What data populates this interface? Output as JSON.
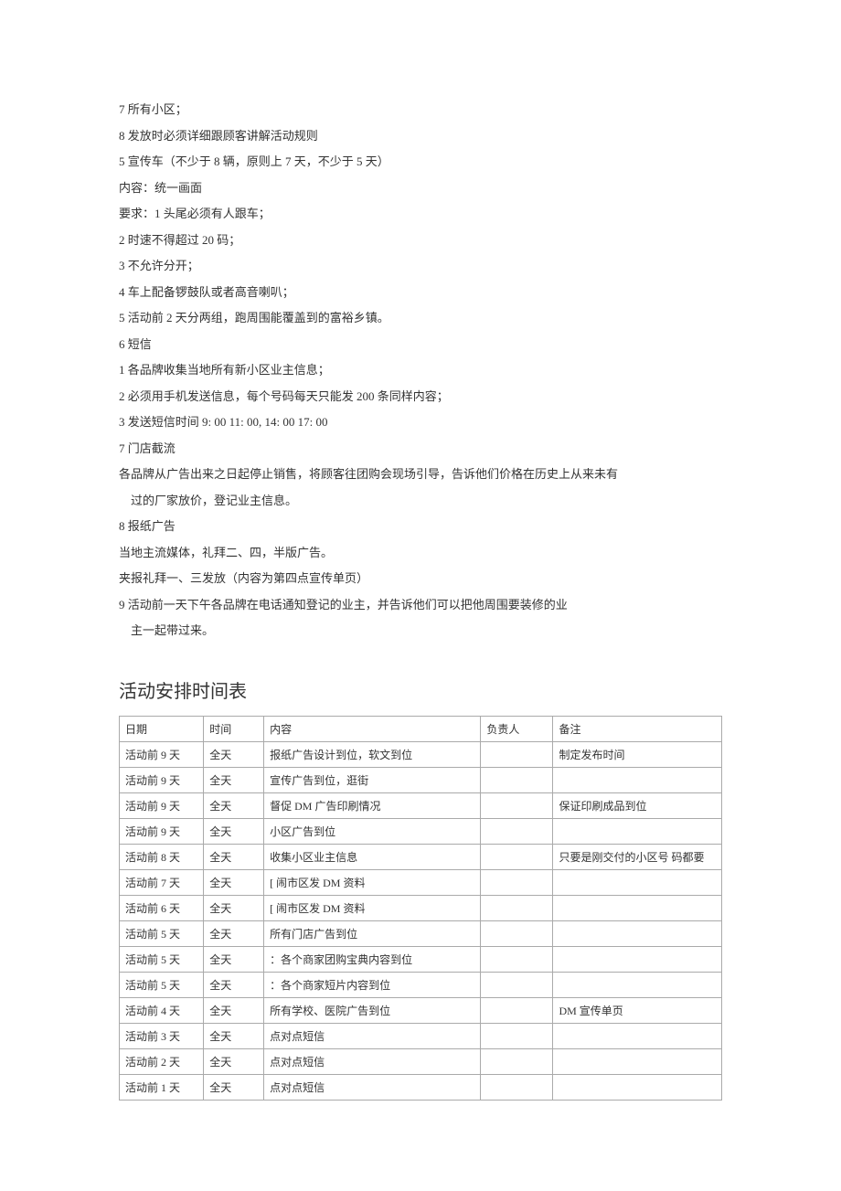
{
  "lines": [
    "7 所有小区；",
    "8 发放时必须详细跟顾客讲解活动规则",
    "5 宣传车（不少于 8 辆，原则上 7 天，不少于 5 天）",
    "内容：统一画面",
    "要求：1 头尾必须有人跟车；",
    "2 时速不得超过 20 码；",
    "3 不允许分开；",
    "4 车上配备锣鼓队或者高音喇叭；",
    "5 活动前 2 天分两组，跑周围能覆盖到的富裕乡镇。",
    "6 短信",
    "1 各品牌收集当地所有新小区业主信息；",
    "2 必须用手机发送信息，每个号码每天只能发 200 条同样内容；",
    "3 发送短信时间 9: 00 11: 00, 14: 00 17: 00",
    "7 门店截流",
    "各品牌从广告出来之日起停止销售，将顾客往团购会现场引导，告诉他们价格在历史上从来未有",
    " 过的厂家放价，登记业主信息。",
    "8 报纸广告",
    "当地主流媒体，礼拜二、四，半版广告。",
    "夹报礼拜一、三发放（内容为第四点宣传单页）",
    "9 活动前一天下午各品牌在电话通知登记的业主，并告诉他们可以把他周围要装修的业",
    " 主一起带过来。"
  ],
  "tableTitle": "活动安排时间表",
  "tableHeaders": [
    "日期",
    "时间",
    "内容",
    "负责人",
    "备注"
  ],
  "rows": [
    [
      "活动前 9 天",
      "全天",
      "报纸广告设计到位，软文到位",
      "",
      "制定发布时间"
    ],
    [
      "活动前 9 天",
      "全天",
      "宣传广告到位，逛街",
      "",
      ""
    ],
    [
      "活动前 9 天",
      "全天",
      "督促 DM 广告印刷情况",
      "",
      "保证印刷成品到位"
    ],
    [
      "活动前 9 天",
      "全天",
      "小区广告到位",
      "",
      ""
    ],
    [
      "活动前 8 天",
      "全天",
      "收集小区业主信息",
      "",
      "只要是刚交付的小区号 码都要"
    ],
    [
      "活动前 7 天",
      "全天",
      "[ 闹市区发 DM 资料",
      "",
      ""
    ],
    [
      "活动前 6 天",
      "全天",
      "[ 闹市区发 DM 资料",
      "",
      ""
    ],
    [
      "活动前 5 天",
      "全天",
      "所有门店广告到位",
      "",
      ""
    ],
    [
      "活动前 5 天",
      "全天",
      "：各个商家团购宝典内容到位",
      "",
      ""
    ],
    [
      "活动前 5 天",
      "全天",
      "：各个商家短片内容到位",
      "",
      ""
    ],
    [
      "活动前 4 天",
      "全天",
      "所有学校、医院广告到位",
      "",
      "DM 宣传单页"
    ],
    [
      "活动前 3 天",
      "全天",
      "点对点短信",
      "",
      ""
    ],
    [
      "活动前 2 天",
      "全天",
      "点对点短信",
      "",
      ""
    ],
    [
      "活动前 1 天",
      "全天",
      "点对点短信",
      "",
      ""
    ]
  ]
}
